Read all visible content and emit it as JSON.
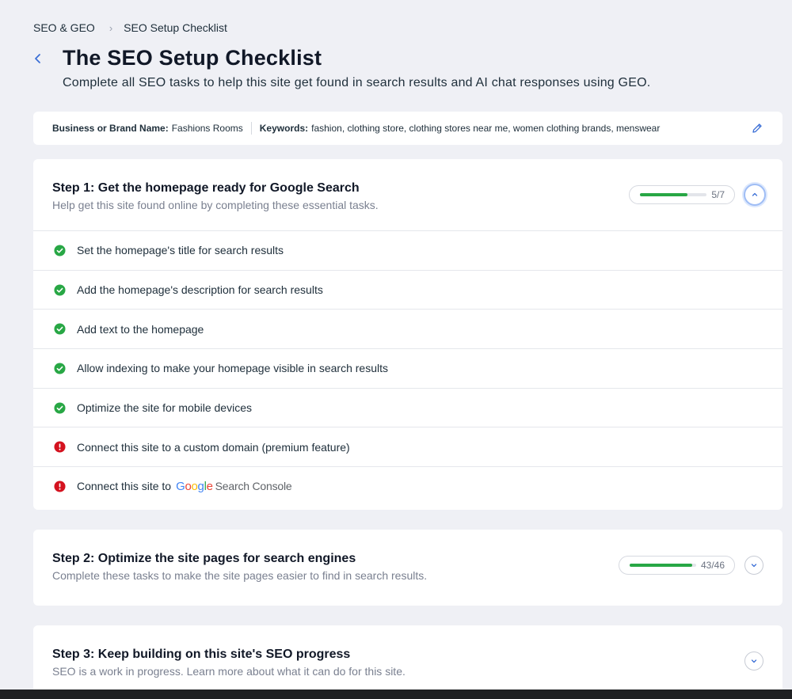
{
  "breadcrumb": {
    "parent": "SEO & GEO",
    "current": "SEO Setup Checklist"
  },
  "page": {
    "title": "The SEO Setup Checklist",
    "subtitle": "Complete all SEO tasks to help this site get found in search results and AI chat responses using GEO."
  },
  "info": {
    "brand_label": "Business or Brand Name:",
    "brand_value": "Fashions Rooms",
    "keywords_label": "Keywords:",
    "keywords_value": "fashion, clothing store, clothing stores near me, women clothing brands, menswear"
  },
  "steps": [
    {
      "title": "Step 1: Get the homepage ready for Google Search",
      "description": "Help get this site found online by completing these essential tasks.",
      "progress_text": "5/7",
      "progress": 0.714,
      "expanded": true,
      "tasks": [
        {
          "label": "Set the homepage's title for search results",
          "status": "done"
        },
        {
          "label": "Add the homepage's description for search results",
          "status": "done"
        },
        {
          "label": "Add text to the homepage",
          "status": "done"
        },
        {
          "label": "Allow indexing to make your homepage visible in search results",
          "status": "done"
        },
        {
          "label": "Optimize the site for mobile devices",
          "status": "done"
        },
        {
          "label": "Connect this site to a custom domain (premium feature)",
          "status": "error"
        },
        {
          "label": "Connect this site to",
          "status": "error",
          "logo_text": "Google",
          "logo_suffix": "Search Console"
        }
      ]
    },
    {
      "title": "Step 2: Optimize the site pages for search engines",
      "description": "Complete these tasks to make the site pages easier to find in search results.",
      "progress_text": "43/46",
      "progress": 0.935,
      "expanded": false
    },
    {
      "title": "Step 3: Keep building on this site's SEO progress",
      "description": "SEO is a work in progress. Learn more about what it can do for this site.",
      "expanded": false
    }
  ],
  "colors": {
    "accent": "#3b6fd6",
    "success": "#28a745",
    "error": "#d4121f",
    "background": "#eff0f5"
  },
  "icons": {
    "back": "chevron-left-icon",
    "edit": "pencil-icon",
    "done": "check-circle-icon",
    "error": "alert-circle-icon",
    "collapse": "chevron-up-icon",
    "expand": "chevron-down-icon"
  }
}
